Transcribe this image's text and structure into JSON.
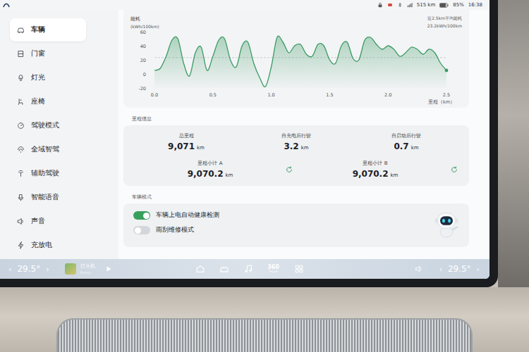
{
  "status_bar": {
    "range": "515 km",
    "battery": "85%",
    "battery_level": 0.85,
    "time": "16:38"
  },
  "sidebar": {
    "items": [
      {
        "label": "车辆",
        "selected": true
      },
      {
        "label": "门窗",
        "selected": false
      },
      {
        "label": "灯光",
        "selected": false
      },
      {
        "label": "座椅",
        "selected": false
      },
      {
        "label": "驾驶模式",
        "selected": false
      },
      {
        "label": "全域智驾",
        "selected": false
      },
      {
        "label": "辅助驾驶",
        "selected": false
      },
      {
        "label": "智能语音",
        "selected": false
      },
      {
        "label": "声音",
        "selected": false
      },
      {
        "label": "充放电",
        "selected": false
      }
    ]
  },
  "chart": {
    "title": "能耗",
    "unit": "(kWh/100km)",
    "summary_label": "近2.5km平均能耗",
    "summary_value": "23.2kWh/100km",
    "y_ticks": [
      "60",
      "40",
      "20",
      "0",
      "-20"
    ],
    "x_ticks": [
      "0.0",
      "0.5",
      "1.0",
      "1.5",
      "2.0",
      "2.5"
    ],
    "x_axis_label": "里程（km）",
    "average": 23.2,
    "series": [
      {
        "name": "能耗",
        "color": "#3a9a62",
        "values": [
          5,
          8,
          25,
          48,
          50,
          15,
          -3,
          30,
          38,
          5,
          25,
          48,
          50,
          20,
          10,
          40,
          45,
          15,
          -5,
          -18,
          10,
          52,
          45,
          30,
          40,
          42,
          28,
          25,
          42,
          40,
          20,
          15,
          40,
          45,
          22,
          20,
          48,
          52,
          42,
          35,
          40,
          35,
          25,
          30,
          38,
          35,
          28,
          35,
          30,
          15,
          5
        ]
      }
    ]
  },
  "mileage": {
    "title": "里程信息",
    "stats": [
      {
        "label": "总里程",
        "value": "9,071",
        "unit": "km",
        "resettable": false
      },
      {
        "label": "自充电后行驶",
        "value": "3.2",
        "unit": "km",
        "resettable": false
      },
      {
        "label": "自启动后行驶",
        "value": "0.7",
        "unit": "km",
        "resettable": false
      },
      {
        "label": "里程小计 A",
        "value": "9,070.2",
        "unit": "km",
        "resettable": true
      },
      {
        "label": "里程小计 B",
        "value": "9,070.2",
        "unit": "km",
        "resettable": true
      }
    ]
  },
  "vehicle_mode": {
    "title": "车辆模式",
    "options": [
      {
        "label": "车辆上电自动健康检测",
        "on": true
      },
      {
        "label": "雨刮维修模式",
        "on": false
      }
    ]
  },
  "dock": {
    "left_temp": {
      "decrease": "‹",
      "value": "29.5°",
      "increase": "›"
    },
    "media": {
      "title": "打火机",
      "artist": "Penny",
      "playing": false
    },
    "camera_label": "360",
    "right_temp": {
      "decrease": "‹",
      "value": "29.5°",
      "increase": "›"
    }
  }
}
